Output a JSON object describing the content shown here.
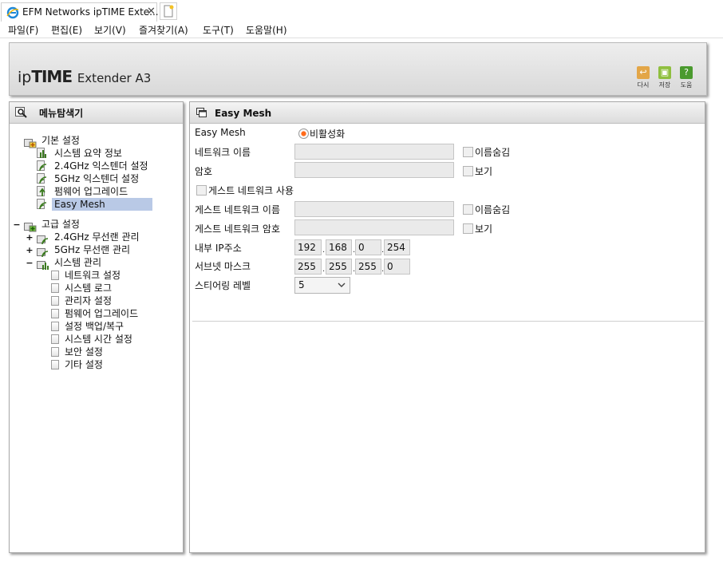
{
  "browser": {
    "tab_title": "EFM Networks ipTIME Exte...",
    "tab_close": "✕",
    "menu": [
      "파일(F)",
      "편집(E)",
      "보기(V)",
      "즐겨찾기(A)",
      "도구(T)",
      "도움말(H)"
    ]
  },
  "header": {
    "logo_ip": "ip",
    "logo_time": "TIME",
    "logo_model": "Extender A3",
    "buttons": [
      {
        "label": "다시",
        "icon": "undo-icon",
        "color": "#e3a648"
      },
      {
        "label": "저장",
        "icon": "save-icon",
        "color": "#8fbf3f"
      },
      {
        "label": "도움",
        "icon": "help-icon",
        "color": "#4a9a2e"
      }
    ]
  },
  "nav": {
    "title": "메뉴탐색기",
    "basic": {
      "label": "기본 설정",
      "items": [
        "시스템 요약 정보",
        "2.4GHz 익스텐더 설정",
        "5GHz 익스텐더 설정",
        "펌웨어 업그레이드",
        "Easy Mesh"
      ],
      "selected": "Easy Mesh"
    },
    "advanced": {
      "label": "고급 설정",
      "expander": "−",
      "groups": [
        {
          "label": "2.4GHz 무선랜 관리",
          "expander": "+"
        },
        {
          "label": "5GHz 무선랜 관리",
          "expander": "+"
        },
        {
          "label": "시스템 관리",
          "expander": "−"
        }
      ],
      "system_items": [
        "네트워크 설정",
        "시스템 로그",
        "관리자 설정",
        "펌웨어 업그레이드",
        "설정 백업/복구",
        "시스템 시간 설정",
        "보안 설정",
        "기타 설정"
      ]
    }
  },
  "content": {
    "title": "Easy Mesh",
    "easymesh_label": "Easy Mesh",
    "easymesh_value": "비활성화",
    "network_name_label": "네트워크 이름",
    "hide_name_label": "이름숨김",
    "password_label": "암호",
    "show_label": "보기",
    "guest_network_label": "게스트 네트워크 사용",
    "guest_name_label": "게스트 네트워크 이름",
    "guest_hide_label": "이름숨김",
    "guest_password_label": "게스트 네트워크 암호",
    "guest_show_label": "보기",
    "ip_label": "내부 IP주소",
    "ip": [
      "192",
      "168",
      "0",
      "254"
    ],
    "subnet_label": "서브넷 마스크",
    "subnet": [
      "255",
      "255",
      "255",
      "0"
    ],
    "steering_label": "스티어링 레벨",
    "steering_value": "5",
    "dot": "."
  }
}
